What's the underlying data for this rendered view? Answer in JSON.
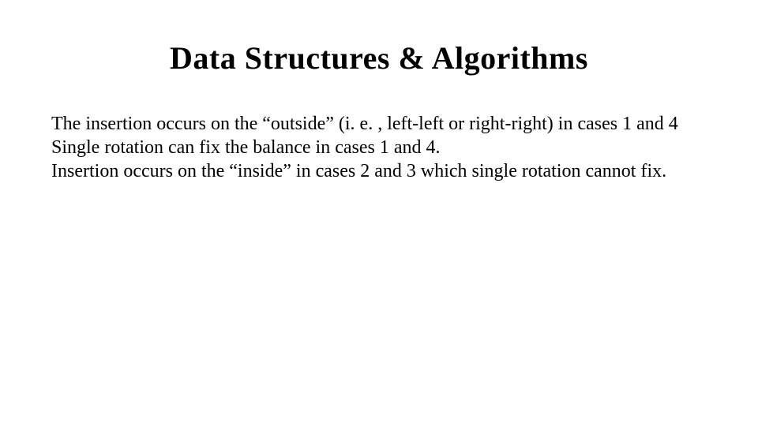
{
  "slide": {
    "title": "Data Structures & Algorithms",
    "paragraphs": [
      "The insertion occurs on the “outside” (i. e. , left-left or right-right) in cases 1 and 4",
      "Single rotation can fix the balance in cases 1 and 4.",
      "Insertion occurs on the “inside” in cases 2 and 3 which single rotation cannot fix."
    ]
  }
}
